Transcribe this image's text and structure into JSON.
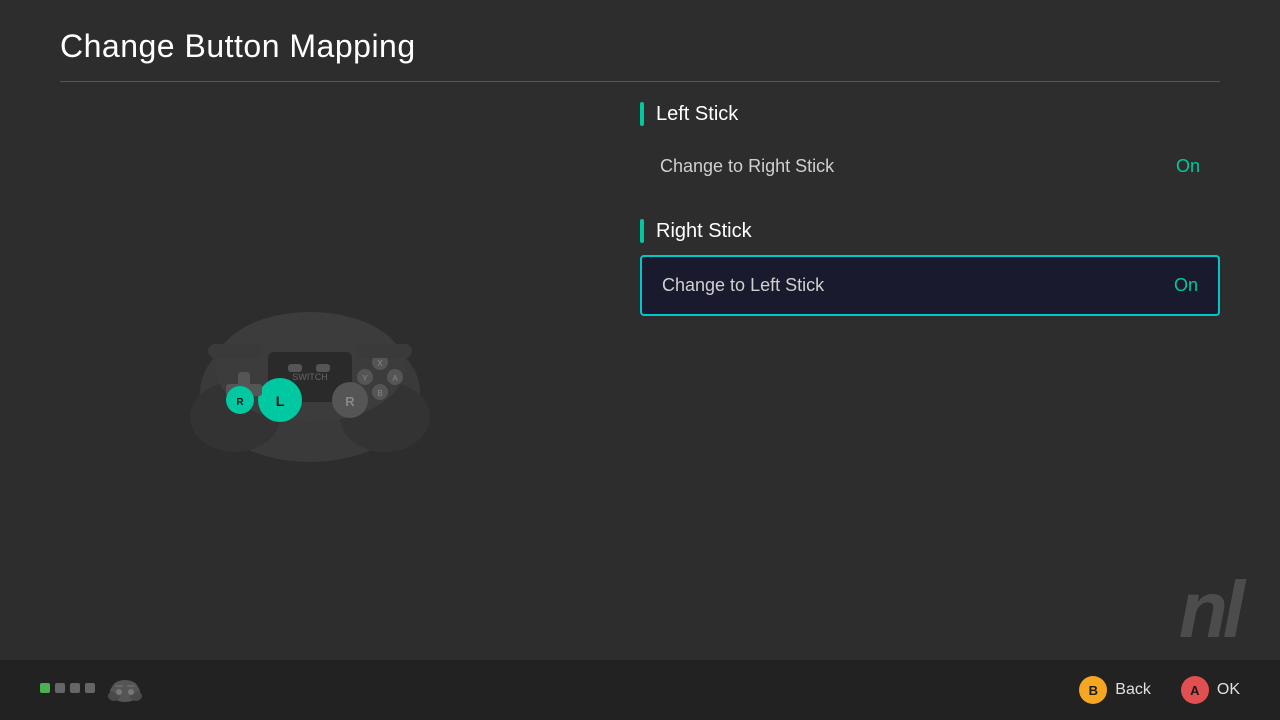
{
  "header": {
    "title": "Change Button Mapping"
  },
  "sections": [
    {
      "id": "left-stick",
      "title": "Left Stick",
      "options": [
        {
          "label": "Change to Right Stick",
          "value": "On",
          "focused": false
        }
      ]
    },
    {
      "id": "right-stick",
      "title": "Right Stick",
      "options": [
        {
          "label": "Change to Left Stick",
          "value": "On",
          "focused": true
        }
      ]
    }
  ],
  "footer": {
    "back_label": "Back",
    "ok_label": "OK",
    "back_btn": "B",
    "ok_btn": "A"
  },
  "watermark": "nl"
}
